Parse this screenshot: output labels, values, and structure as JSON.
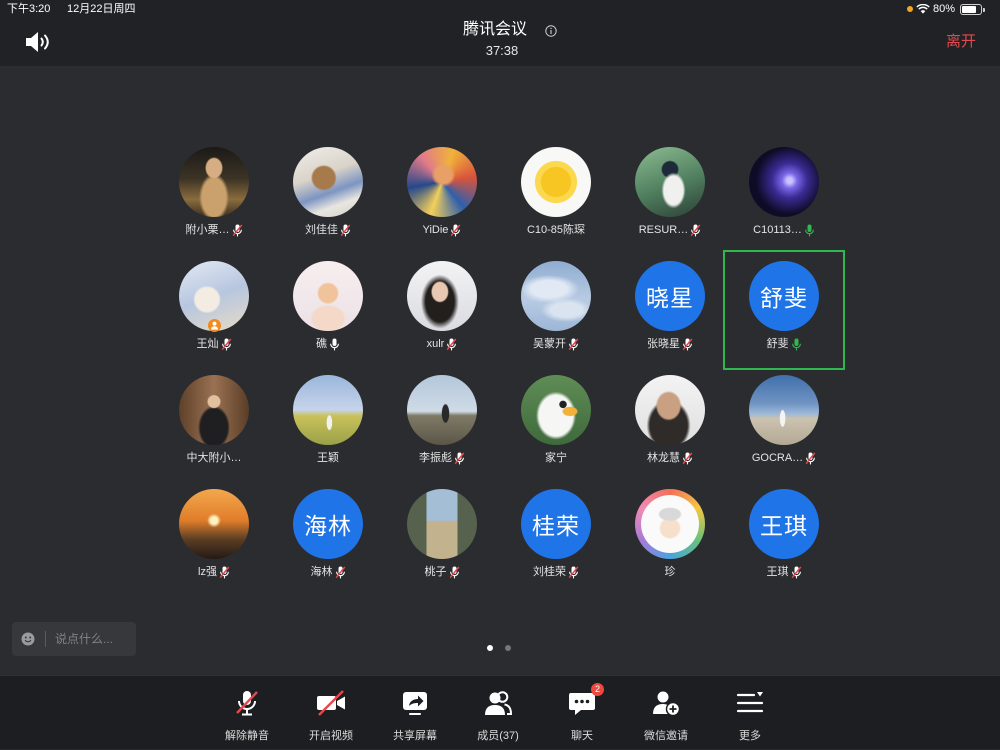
{
  "status_bar": {
    "time": "下午3:20",
    "date": "12月22日周四",
    "battery": "80%",
    "icons": [
      "recording-dot-icon",
      "wifi-icon",
      "battery-icon"
    ]
  },
  "header": {
    "title": "腾讯会议",
    "timer": "37:38",
    "leave_label": "离开",
    "speaker_icon": "speaker-icon",
    "info_icon": "info-icon"
  },
  "participants": [
    {
      "name": "附小栗…",
      "mic_icon": "mic-muted-icon"
    },
    {
      "name": "刘佳佳",
      "mic_icon": "mic-muted-icon"
    },
    {
      "name": "YiDie",
      "mic_icon": "mic-muted-icon"
    },
    {
      "name": "C10-85陈琛"
    },
    {
      "name": "RESUR…",
      "mic_icon": "mic-muted-icon"
    },
    {
      "name": "C10113…",
      "mic_icon": "mic-speaking-icon"
    },
    {
      "name": "王灿",
      "mic_icon": "mic-muted-icon",
      "badge_icon": "host-badge-icon"
    },
    {
      "name": "礁",
      "mic_icon": "mic-on-icon"
    },
    {
      "name": "xulr",
      "mic_icon": "mic-muted-icon"
    },
    {
      "name": "吴蒙开",
      "mic_icon": "mic-muted-icon"
    },
    {
      "name": "张晓星",
      "avatar_text": "晓星",
      "mic_icon": "mic-muted-icon"
    },
    {
      "name": "舒斐",
      "avatar_text": "舒斐",
      "mic_icon": "mic-speaking-icon",
      "active_speaker": true
    },
    {
      "name": "中大附小…"
    },
    {
      "name": "王颖"
    },
    {
      "name": "李振彪",
      "mic_icon": "mic-muted-icon"
    },
    {
      "name": "家宁"
    },
    {
      "name": "林龙慧",
      "mic_icon": "mic-muted-icon"
    },
    {
      "name": "GOCRA…",
      "mic_icon": "mic-muted-icon"
    },
    {
      "name": "lz强",
      "mic_icon": "mic-muted-icon"
    },
    {
      "name": "海林",
      "avatar_text": "海林",
      "mic_icon": "mic-muted-icon"
    },
    {
      "name": "桃子",
      "mic_icon": "mic-muted-icon"
    },
    {
      "name": "刘桂荣",
      "avatar_text": "桂荣",
      "mic_icon": "mic-muted-icon"
    },
    {
      "name": "珍"
    },
    {
      "name": "王琪",
      "avatar_text": "王琪",
      "mic_icon": "mic-muted-icon"
    }
  ],
  "chat": {
    "placeholder": "说点什么...",
    "icon": "emoji-icon"
  },
  "pagination": {
    "page_count": 2,
    "current_page": 1
  },
  "toolbar": {
    "items": [
      {
        "label": "解除静音",
        "icon": "mic-muted-icon"
      },
      {
        "label": "开启视频",
        "icon": "video-off-icon"
      },
      {
        "label": "共享屏幕",
        "icon": "share-screen-icon"
      },
      {
        "label": "成员(37)",
        "icon": "members-icon"
      },
      {
        "label": "聊天",
        "icon": "chat-icon",
        "badge": "2"
      },
      {
        "label": "微信邀请",
        "icon": "wechat-invite-icon"
      },
      {
        "label": "更多",
        "icon": "more-icon"
      }
    ]
  },
  "colors": {
    "leave": "#e5484d",
    "speaking": "#2fb84f",
    "avatar_blue": "#1f74e8",
    "muted_slash": "#e5484d",
    "badge": "#f0483e",
    "host_badge": "#f28a1c",
    "recording_dot": "#f5a524"
  }
}
